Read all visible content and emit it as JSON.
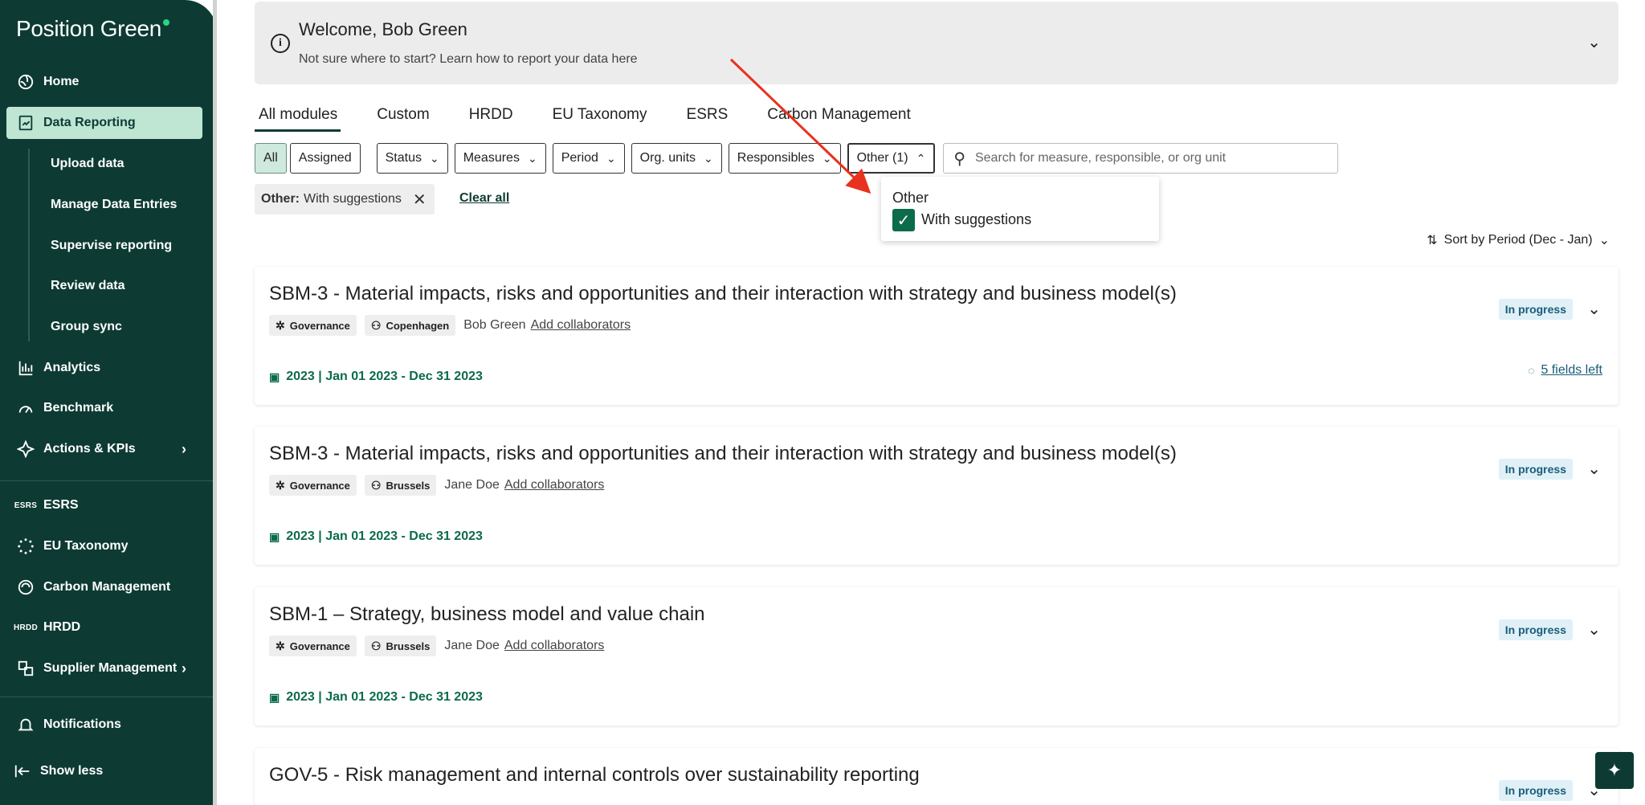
{
  "sidebar": {
    "logo": "Position Green",
    "items": [
      {
        "label": "Home",
        "icon": "home-icon"
      },
      {
        "label": "Data Reporting",
        "icon": "data-reporting-icon"
      },
      {
        "label": "Analytics",
        "icon": "analytics-icon"
      },
      {
        "label": "Benchmark",
        "icon": "benchmark-icon"
      },
      {
        "label": "Actions & KPIs",
        "icon": "actions-kpis-icon"
      },
      {
        "label": "ESRS",
        "icon": "esrs-icon",
        "mini": "ESRS"
      },
      {
        "label": "EU Taxonomy",
        "icon": "eu-taxonomy-icon"
      },
      {
        "label": "Carbon Management",
        "icon": "carbon-management-icon"
      },
      {
        "label": "HRDD",
        "icon": "hrdd-icon",
        "mini": "HRDD"
      },
      {
        "label": "Supplier Management",
        "icon": "supplier-management-icon"
      },
      {
        "label": "Notifications",
        "icon": "notifications-icon"
      },
      {
        "label": "Show less",
        "icon": "collapse-icon"
      }
    ],
    "sub_items": [
      {
        "label": "Upload data"
      },
      {
        "label": "Manage Data Entries"
      },
      {
        "label": "Supervise reporting"
      },
      {
        "label": "Review data"
      },
      {
        "label": "Group sync"
      }
    ]
  },
  "welcome": {
    "title": "Welcome, Bob Green",
    "subtitle": "Not sure where to start? Learn how to report your data here"
  },
  "tabs": [
    {
      "label": "All modules",
      "active": true
    },
    {
      "label": "Custom"
    },
    {
      "label": "HRDD"
    },
    {
      "label": "EU Taxonomy"
    },
    {
      "label": "ESRS"
    },
    {
      "label": "Carbon Management"
    }
  ],
  "filters": {
    "all": "All",
    "assigned": "Assigned",
    "status": "Status",
    "measures": "Measures",
    "period": "Period",
    "org_units": "Org. units",
    "responsibles": "Responsibles",
    "other": "Other (1)",
    "search_placeholder": "Search for measure, responsible, or org unit"
  },
  "active_filter": {
    "key": "Other:",
    "value": "With suggestions",
    "clear_all": "Clear all"
  },
  "dropdown": {
    "title": "Other",
    "option": "With suggestions",
    "checked": true
  },
  "sort": {
    "label": "Sort by Period (Dec - Jan)"
  },
  "cards": [
    {
      "title": "SBM-3 - Material impacts, risks and opportunities and their interaction with strategy and business model(s)",
      "tag_topic": "Governance",
      "tag_org": "Copenhagen",
      "person": "Bob Green",
      "collab": "Add collaborators",
      "date": "2023 | Jan 01 2023 - Dec 31 2023",
      "status": "In progress",
      "fields_left": "5 fields left"
    },
    {
      "title": "SBM-3 - Material impacts, risks and opportunities and their interaction with strategy and business model(s)",
      "tag_topic": "Governance",
      "tag_org": "Brussels",
      "person": "Jane Doe",
      "collab": "Add collaborators",
      "date": "2023 | Jan 01 2023 - Dec 31 2023",
      "status": "In progress"
    },
    {
      "title": "SBM-1 – Strategy, business model and value chain",
      "tag_topic": "Governance",
      "tag_org": "Brussels",
      "person": "Jane Doe",
      "collab": "Add collaborators",
      "date": "2023 | Jan 01 2023 - Dec 31 2023",
      "status": "In progress"
    },
    {
      "title": "GOV-5 - Risk management and internal controls over sustainability reporting",
      "status": "In progress"
    }
  ],
  "colors": {
    "sidebar_bg": "#0d3b34",
    "active_nav": "#bfe5d3",
    "accent_green": "#0b6b4b",
    "status_bg": "#dff0f7",
    "annotation_arrow": "#e8321f"
  }
}
